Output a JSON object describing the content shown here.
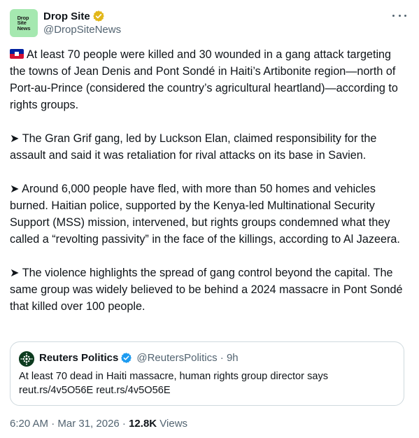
{
  "author": {
    "avatar_text": "Drop\nSite\nNews",
    "display_name": "Drop Site",
    "handle": "@DropSiteNews",
    "avatar_color": "#a5e8b0",
    "badge_color": "#e2b719"
  },
  "more_icon": "more-horizontal-icon",
  "flag_icon": "haiti-flag-icon",
  "body": {
    "p1": "At least 70 people were killed and 30 wounded in a gang attack targeting the towns of Jean Denis and Pont Sondé in Haiti’s Artibonite region—north of Port-au-Prince (considered the country’s agricultural heartland)—according to rights groups.",
    "p2": "➤ The Gran Grif gang, led by Luckson Elan, claimed responsibility for the assault and said it was retaliation for rival attacks on its base in Savien.",
    "p3": "➤ Around 6,000 people have fled, with more than 50 homes and vehicles burned. Haitian police, supported by the Kenya-led Multinational Security Support (MSS) mission, intervened, but rights groups condemned what they called a “revolting passivity” in the face of the killings, according to Al Jazeera.",
    "p4": "➤ The violence highlights the spread of gang control beyond the capital. The same group was widely believed to be behind a 2024 massacre in Pont Sondé that killed over 100 people."
  },
  "quoted": {
    "display_name": "Reuters Politics",
    "handle_time": "@ReutersPolitics · 9h",
    "text_line1": "At least 70 dead in Haiti massacre, human rights group director says",
    "text_line2": "reut.rs/4v5O56E reut.rs/4v5O56E",
    "badge_color": "#1d9bf0"
  },
  "meta": {
    "timestamp": "6:20 AM · Mar 31, 2026 · ",
    "views_count": "12.8K",
    "views_label": " Views"
  }
}
